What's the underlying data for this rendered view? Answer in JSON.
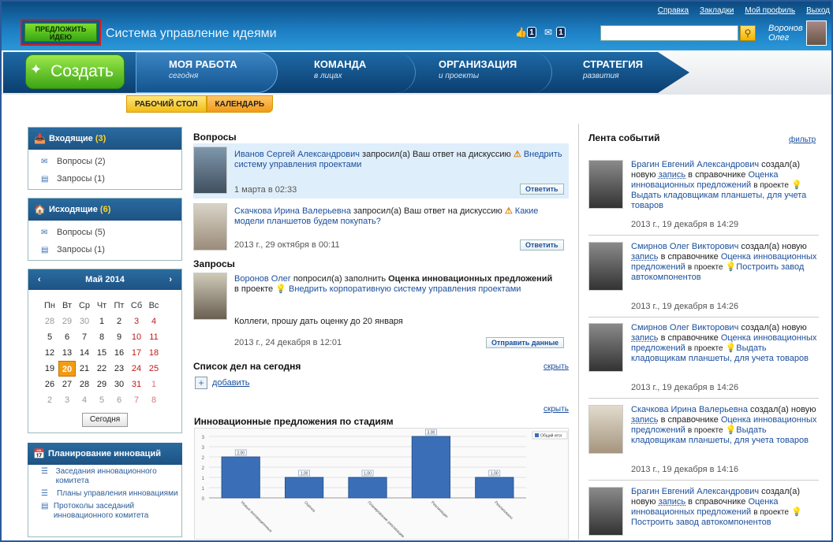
{
  "toplinks": [
    "Справка",
    "Закладки",
    "Мой профиль",
    "Выход"
  ],
  "header": {
    "idea_button": "ПРЕДЛОЖИТЬ ИДЕЮ",
    "app_title": "Система управление идеями",
    "likes_count": "1",
    "messages_count": "1",
    "user_first": "Воронов",
    "user_last": "Олег",
    "search_placeholder": ""
  },
  "nav": {
    "create": "Создать",
    "items": [
      {
        "title": "МОЯ РАБОТА",
        "sub": "сегодня"
      },
      {
        "title": "КОМАНДА",
        "sub": "в лицах"
      },
      {
        "title": "ОРГАНИЗАЦИЯ",
        "sub": "и проекты"
      },
      {
        "title": "СТРАТЕГИЯ",
        "sub": "развития"
      }
    ],
    "subtabs": [
      "РАБОЧИЙ СТОЛ",
      "КАЛЕНДАРЬ"
    ]
  },
  "inbox": {
    "title": "Входящие",
    "count": "(3)",
    "rows": [
      "Вопросы (2)",
      "Запросы (1)"
    ]
  },
  "outbox": {
    "title": "Исходящие",
    "count": "(6)",
    "rows": [
      "Вопросы (5)",
      "Запросы (1)"
    ]
  },
  "calendar": {
    "month": "Май 2014",
    "weekdays": [
      "Пн",
      "Вт",
      "Ср",
      "Чт",
      "Пт",
      "Сб",
      "Вс"
    ],
    "today_button": "Сегодня"
  },
  "planning": {
    "title": "Планирование инноваций",
    "items": [
      "Заседания инновационного комитета",
      "Планы управления инновациями",
      "Протоколы заседаний инновационного комитета"
    ]
  },
  "questions": {
    "title": "Вопросы",
    "items": [
      {
        "author": "Иванов Сергей Александрович",
        "verb": "запросил(а) Ваш ответ на дискуссию",
        "topic": "Внедрить систему управления проектами",
        "date": "1 марта в 02:33",
        "button": "Ответить"
      },
      {
        "author": "Скачкова Ирина Валерьевна",
        "verb": "запросил(а) Ваш ответ на дискуссию",
        "topic": "Какие модели планшетов будем покупать?",
        "date": "2013 г., 29 октября в 00:11",
        "button": "Ответить"
      }
    ]
  },
  "requests": {
    "title": "Запросы",
    "author": "Воронов Олег",
    "verb": "попросил(а) заполнить",
    "form": "Оценка инновационных предложений",
    "in_project": "в проекте",
    "project": "Внедрить корпоративную систему управления проектами",
    "note": "Коллеги, прошу дать оценку до 20 января",
    "date": "2013 г., 24 декабря в 12:01",
    "button": "Отправить данные"
  },
  "todo": {
    "title": "Список дел на сегодня",
    "hide": "скрыть",
    "add": "добавить"
  },
  "chart_section": {
    "title": "Инновационные предложения по стадиям",
    "hide": "скрыть"
  },
  "chart_data": {
    "type": "bar",
    "legend": "Общий итог",
    "legend_position": "top-right",
    "categories": [
      "Новые инновационные",
      "Оценка",
      "Планирование реализации",
      "Реализация",
      "Реализовано"
    ],
    "values": [
      2,
      1,
      1,
      3,
      1
    ],
    "data_labels": [
      "2,00",
      "1,00",
      "1,00",
      "3,00",
      "1,00"
    ],
    "ylim": [
      0,
      3
    ],
    "yticks": [
      "0",
      "1",
      "1",
      "2",
      "2",
      "3",
      "3"
    ],
    "grid": true
  },
  "feed": {
    "title": "Лента событий",
    "filter": "фильтр",
    "items": [
      {
        "author": "Брагин Евгений Александрович",
        "action": "создал(а) новую",
        "link": "запись",
        "in_ref": "в справочнике",
        "ref": "Оценка инновационных предложений",
        "in_project": "в проекте",
        "project": "Выдать кладовщикам планшеты, для учета товаров",
        "date": "2013 г., 19 декабря в 14:29"
      },
      {
        "author": "Смирнов Олег Викторович",
        "action": "создал(а) новую",
        "link": "запись",
        "in_ref": "в справочнике",
        "ref": "Оценка инновационных предложений",
        "in_project": "в проекте",
        "project": "Построить завод автокомпонентов",
        "date": "2013 г., 19 декабря в 14:26"
      },
      {
        "author": "Смирнов Олег Викторович",
        "action": "создал(а) новую",
        "link": "запись",
        "in_ref": "в справочнике",
        "ref": "Оценка инновационных предложений",
        "in_project": "в проекте",
        "project": "Выдать кладовщикам планшеты, для учета товаров",
        "date": "2013 г., 19 декабря в 14:26"
      },
      {
        "author": "Скачкова Ирина Валерьевна",
        "action": "создал(а) новую",
        "link": "запись",
        "in_ref": "в справочнике",
        "ref": "Оценка инновационных предложений",
        "in_project": "в проекте",
        "project": "Выдать кладовщикам планшеты, для учета товаров",
        "date": "2013 г., 19 декабря в 14:16"
      },
      {
        "author": "Брагин Евгений Александрович",
        "action": "создал(а) новую",
        "link": "запись",
        "in_ref": "в справочнике",
        "ref": "Оценка инновационных предложений",
        "in_project": "в проекте",
        "project": "Построить завод автокомпонентов",
        "date": ""
      }
    ]
  },
  "colors": {
    "brand_blue": "#1d5384",
    "accent_green": "#3da515",
    "today": "#f39c12",
    "bar": "#3a6fb8"
  }
}
